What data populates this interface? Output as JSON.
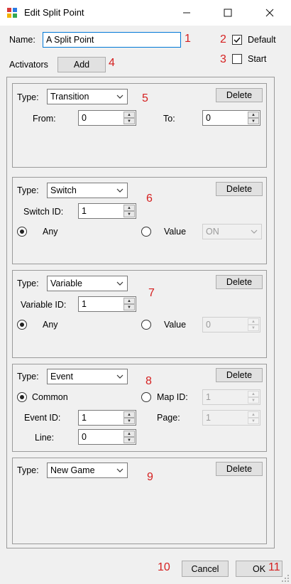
{
  "window": {
    "title": "Edit Split Point",
    "icons": [
      "app-icon",
      "minimize-icon",
      "maximize-icon",
      "close-icon"
    ]
  },
  "form": {
    "name_label": "Name:",
    "name_value": "A Split Point",
    "default_label": "Default",
    "default_checked": true,
    "start_label": "Start",
    "start_checked": false,
    "activators_label": "Activators",
    "add_button": "Add"
  },
  "annotations": [
    "1",
    "2",
    "3",
    "4",
    "5",
    "6",
    "7",
    "8",
    "9",
    "10",
    "11"
  ],
  "activators": {
    "transition": {
      "type_label": "Type:",
      "type_value": "Transition",
      "delete_button": "Delete",
      "from_label": "From:",
      "from_value": "0",
      "to_label": "To:",
      "to_value": "0"
    },
    "switch": {
      "type_label": "Type:",
      "type_value": "Switch",
      "delete_button": "Delete",
      "id_label": "Switch ID:",
      "id_value": "1",
      "any_label": "Any",
      "any_selected": true,
      "value_label": "Value",
      "value_selected": false,
      "value_select": "ON"
    },
    "variable": {
      "type_label": "Type:",
      "type_value": "Variable",
      "delete_button": "Delete",
      "id_label": "Variable ID:",
      "id_value": "1",
      "any_label": "Any",
      "any_selected": true,
      "value_label": "Value",
      "value_selected": false,
      "value_number": "0"
    },
    "event": {
      "type_label": "Type:",
      "type_value": "Event",
      "delete_button": "Delete",
      "common_label": "Common",
      "common_selected": true,
      "map_id_label": "Map ID:",
      "map_selected": false,
      "map_id_value": "1",
      "event_id_label": "Event ID:",
      "event_id_value": "1",
      "page_label": "Page:",
      "page_value": "1",
      "line_label": "Line:",
      "line_value": "0"
    },
    "new_game": {
      "type_label": "Type:",
      "type_value": "New Game",
      "delete_button": "Delete"
    }
  },
  "footer": {
    "cancel_button": "Cancel",
    "ok_button": "OK"
  }
}
